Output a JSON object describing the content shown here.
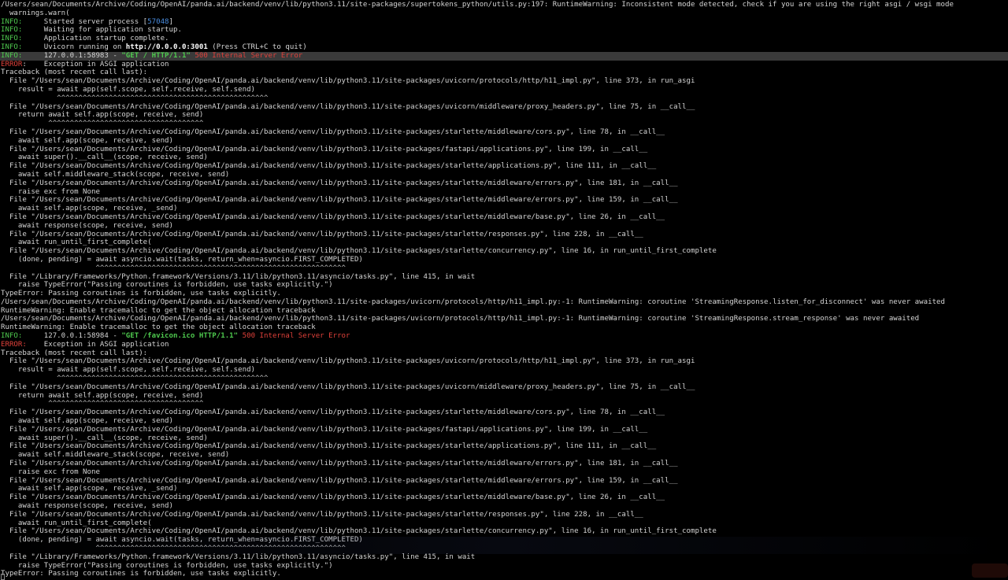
{
  "lines": [
    {
      "s": [
        {
          "t": "/Users/sean/Documents/Archive/Coding/OpenAI/panda.ai/backend/venv/lib/python3.11/site-packages/supertokens_python/utils.py:197: RuntimeWarning: Inconsistent mode detected, check if you are using the right asgi / wsgi mode"
        }
      ]
    },
    {
      "s": [
        {
          "t": "  warnings.warn("
        }
      ]
    },
    {
      "s": [
        {
          "t": "INFO:",
          "c": "info"
        },
        {
          "t": "     Started server process ["
        },
        {
          "t": "57048",
          "c": "pid"
        },
        {
          "t": "]"
        }
      ]
    },
    {
      "s": [
        {
          "t": "INFO:",
          "c": "info"
        },
        {
          "t": "     Waiting for application startup."
        }
      ]
    },
    {
      "s": [
        {
          "t": "INFO:",
          "c": "info"
        },
        {
          "t": "     Application startup complete."
        }
      ]
    },
    {
      "s": [
        {
          "t": "INFO:",
          "c": "info"
        },
        {
          "t": "     Uvicorn running on "
        },
        {
          "t": "http://0.0.0.0:3001",
          "c": "url"
        },
        {
          "t": " (Press CTRL+C to quit)"
        }
      ]
    },
    {
      "hl": true,
      "s": [
        {
          "t": "INFO:",
          "c": "info"
        },
        {
          "t": "     127.0.0.1:58983 - "
        },
        {
          "t": "\"GET / HTTP/1.1\"",
          "c": "req"
        },
        {
          "t": " "
        },
        {
          "t": "500 Internal Server Error",
          "c": "status"
        }
      ]
    },
    {
      "s": [
        {
          "t": "ERROR",
          "c": "error"
        },
        {
          "t": ":    Exception in ASGI application"
        }
      ]
    },
    {
      "s": [
        {
          "t": "Traceback (most recent call last):"
        }
      ]
    },
    {
      "s": [
        {
          "t": "  File \"/Users/sean/Documents/Archive/Coding/OpenAI/panda.ai/backend/venv/lib/python3.11/site-packages/uvicorn/protocols/http/h11_impl.py\", line 373, in run_asgi"
        }
      ]
    },
    {
      "s": [
        {
          "t": "    result = await app(self.scope, self.receive, self.send)"
        }
      ]
    },
    {
      "s": [
        {
          "t": "             ^^^^^^^^^^^^^^^^^^^^^^^^^^^^^^^^^^^^^^^^^^^^^^^^^",
          "c": "carets"
        }
      ]
    },
    {
      "s": [
        {
          "t": "  File \"/Users/sean/Documents/Archive/Coding/OpenAI/panda.ai/backend/venv/lib/python3.11/site-packages/uvicorn/middleware/proxy_headers.py\", line 75, in __call__"
        }
      ]
    },
    {
      "s": [
        {
          "t": "    return await self.app(scope, receive, send)"
        }
      ]
    },
    {
      "s": [
        {
          "t": "           ^^^^^^^^^^^^^^^^^^^^^^^^^^^^^^^^^^^^",
          "c": "carets"
        }
      ]
    },
    {
      "s": [
        {
          "t": "  File \"/Users/sean/Documents/Archive/Coding/OpenAI/panda.ai/backend/venv/lib/python3.11/site-packages/starlette/middleware/cors.py\", line 78, in __call__"
        }
      ]
    },
    {
      "s": [
        {
          "t": "    await self.app(scope, receive, send)"
        }
      ]
    },
    {
      "s": [
        {
          "t": "  File \"/Users/sean/Documents/Archive/Coding/OpenAI/panda.ai/backend/venv/lib/python3.11/site-packages/fastapi/applications.py\", line 199, in __call__"
        }
      ]
    },
    {
      "s": [
        {
          "t": "    await super().__call__(scope, receive, send)"
        }
      ]
    },
    {
      "s": [
        {
          "t": "  File \"/Users/sean/Documents/Archive/Coding/OpenAI/panda.ai/backend/venv/lib/python3.11/site-packages/starlette/applications.py\", line 111, in __call__"
        }
      ]
    },
    {
      "s": [
        {
          "t": "    await self.middleware_stack(scope, receive, send)"
        }
      ]
    },
    {
      "s": [
        {
          "t": "  File \"/Users/sean/Documents/Archive/Coding/OpenAI/panda.ai/backend/venv/lib/python3.11/site-packages/starlette/middleware/errors.py\", line 181, in __call__"
        }
      ]
    },
    {
      "s": [
        {
          "t": "    raise exc from None"
        }
      ]
    },
    {
      "s": [
        {
          "t": "  File \"/Users/sean/Documents/Archive/Coding/OpenAI/panda.ai/backend/venv/lib/python3.11/site-packages/starlette/middleware/errors.py\", line 159, in __call__"
        }
      ]
    },
    {
      "s": [
        {
          "t": "    await self.app(scope, receive, _send)"
        }
      ]
    },
    {
      "s": [
        {
          "t": "  File \"/Users/sean/Documents/Archive/Coding/OpenAI/panda.ai/backend/venv/lib/python3.11/site-packages/starlette/middleware/base.py\", line 26, in __call__"
        }
      ]
    },
    {
      "s": [
        {
          "t": "    await response(scope, receive, send)"
        }
      ]
    },
    {
      "s": [
        {
          "t": "  File \"/Users/sean/Documents/Archive/Coding/OpenAI/panda.ai/backend/venv/lib/python3.11/site-packages/starlette/responses.py\", line 228, in __call__"
        }
      ]
    },
    {
      "s": [
        {
          "t": "    await run_until_first_complete("
        }
      ]
    },
    {
      "s": [
        {
          "t": "  File \"/Users/sean/Documents/Archive/Coding/OpenAI/panda.ai/backend/venv/lib/python3.11/site-packages/starlette/concurrency.py\", line 16, in run_until_first_complete"
        }
      ]
    },
    {
      "s": [
        {
          "t": "    (done, pending) = await asyncio.wait(tasks, return_when=asyncio.FIRST_COMPLETED)"
        }
      ]
    },
    {
      "s": [
        {
          "t": "                      ^^^^^^^^^^^^^^^^^^^^^^^^^^^^^^^^^^^^^^^^^^^^^^^^^^^^^^^^^^",
          "c": "carets"
        }
      ]
    },
    {
      "s": [
        {
          "t": "  File \"/Library/Frameworks/Python.framework/Versions/3.11/lib/python3.11/asyncio/tasks.py\", line 415, in wait"
        }
      ]
    },
    {
      "s": [
        {
          "t": "    raise TypeError(\"Passing coroutines is forbidden, use tasks explicitly.\")"
        }
      ]
    },
    {
      "s": [
        {
          "t": "TypeError: Passing coroutines is forbidden, use tasks explicitly."
        }
      ]
    },
    {
      "s": [
        {
          "t": "/Users/sean/Documents/Archive/Coding/OpenAI/panda.ai/backend/venv/lib/python3.11/site-packages/uvicorn/protocols/http/h11_impl.py:-1: RuntimeWarning: coroutine 'StreamingResponse.listen_for_disconnect' was never awaited"
        }
      ]
    },
    {
      "s": [
        {
          "t": "RuntimeWarning: Enable tracemalloc to get the object allocation traceback"
        }
      ]
    },
    {
      "s": [
        {
          "t": "/Users/sean/Documents/Archive/Coding/OpenAI/panda.ai/backend/venv/lib/python3.11/site-packages/uvicorn/protocols/http/h11_impl.py:-1: RuntimeWarning: coroutine 'StreamingResponse.stream_response' was never awaited"
        }
      ]
    },
    {
      "s": [
        {
          "t": "RuntimeWarning: Enable tracemalloc to get the object allocation traceback"
        }
      ]
    },
    {
      "s": [
        {
          "t": "INFO:",
          "c": "info"
        },
        {
          "t": "     127.0.0.1:58984 - "
        },
        {
          "t": "\"GET /favicon.ico HTTP/1.1\"",
          "c": "req"
        },
        {
          "t": " "
        },
        {
          "t": "500 Internal Server Error",
          "c": "status"
        }
      ]
    },
    {
      "s": [
        {
          "t": "ERROR:",
          "c": "error"
        },
        {
          "t": "    Exception in ASGI application"
        }
      ]
    },
    {
      "s": [
        {
          "t": "Traceback (most recent call last):"
        }
      ]
    },
    {
      "s": [
        {
          "t": "  File \"/Users/sean/Documents/Archive/Coding/OpenAI/panda.ai/backend/venv/lib/python3.11/site-packages/uvicorn/protocols/http/h11_impl.py\", line 373, in run_asgi"
        }
      ]
    },
    {
      "s": [
        {
          "t": "    result = await app(self.scope, self.receive, self.send)"
        }
      ]
    },
    {
      "s": [
        {
          "t": "             ^^^^^^^^^^^^^^^^^^^^^^^^^^^^^^^^^^^^^^^^^^^^^^^^^",
          "c": "carets"
        }
      ]
    },
    {
      "s": [
        {
          "t": "  File \"/Users/sean/Documents/Archive/Coding/OpenAI/panda.ai/backend/venv/lib/python3.11/site-packages/uvicorn/middleware/proxy_headers.py\", line 75, in __call__"
        }
      ]
    },
    {
      "s": [
        {
          "t": "    return await self.app(scope, receive, send)"
        }
      ]
    },
    {
      "s": [
        {
          "t": "           ^^^^^^^^^^^^^^^^^^^^^^^^^^^^^^^^^^^^",
          "c": "carets"
        }
      ]
    },
    {
      "s": [
        {
          "t": "  File \"/Users/sean/Documents/Archive/Coding/OpenAI/panda.ai/backend/venv/lib/python3.11/site-packages/starlette/middleware/cors.py\", line 78, in __call__"
        }
      ]
    },
    {
      "s": [
        {
          "t": "    await self.app(scope, receive, send)"
        }
      ]
    },
    {
      "s": [
        {
          "t": "  File \"/Users/sean/Documents/Archive/Coding/OpenAI/panda.ai/backend/venv/lib/python3.11/site-packages/fastapi/applications.py\", line 199, in __call__"
        }
      ]
    },
    {
      "s": [
        {
          "t": "    await super().__call__(scope, receive, send)"
        }
      ]
    },
    {
      "s": [
        {
          "t": "  File \"/Users/sean/Documents/Archive/Coding/OpenAI/panda.ai/backend/venv/lib/python3.11/site-packages/starlette/applications.py\", line 111, in __call__"
        }
      ]
    },
    {
      "s": [
        {
          "t": "    await self.middleware_stack(scope, receive, send)"
        }
      ]
    },
    {
      "s": [
        {
          "t": "  File \"/Users/sean/Documents/Archive/Coding/OpenAI/panda.ai/backend/venv/lib/python3.11/site-packages/starlette/middleware/errors.py\", line 181, in __call__"
        }
      ]
    },
    {
      "s": [
        {
          "t": "    raise exc from None"
        }
      ]
    },
    {
      "s": [
        {
          "t": "  File \"/Users/sean/Documents/Archive/Coding/OpenAI/panda.ai/backend/venv/lib/python3.11/site-packages/starlette/middleware/errors.py\", line 159, in __call__"
        }
      ]
    },
    {
      "s": [
        {
          "t": "    await self.app(scope, receive, _send)"
        }
      ]
    },
    {
      "s": [
        {
          "t": "  File \"/Users/sean/Documents/Archive/Coding/OpenAI/panda.ai/backend/venv/lib/python3.11/site-packages/starlette/middleware/base.py\", line 26, in __call__"
        }
      ]
    },
    {
      "s": [
        {
          "t": "    await response(scope, receive, send)"
        }
      ]
    },
    {
      "s": [
        {
          "t": "  File \"/Users/sean/Documents/Archive/Coding/OpenAI/panda.ai/backend/venv/lib/python3.11/site-packages/starlette/responses.py\", line 228, in __call__"
        }
      ]
    },
    {
      "s": [
        {
          "t": "    await run_until_first_complete("
        }
      ]
    },
    {
      "s": [
        {
          "t": "  File \"/Users/sean/Documents/Archive/Coding/OpenAI/panda.ai/backend/venv/lib/python3.11/site-packages/starlette/concurrency.py\", line 16, in run_until_first_complete"
        }
      ]
    },
    {
      "s": [
        {
          "t": "    (done, pending) = await asyncio.wait(tasks, return_when=asyncio.FIRST_COMPLETED)"
        }
      ]
    },
    {
      "s": [
        {
          "t": "                      ^^^^^^^^^^^^^^^^^^^^^^^^^^^^^^^^^^^^^^^^^^^^^^^^^^^^^^^^^^",
          "c": "carets"
        }
      ]
    },
    {
      "s": [
        {
          "t": "  File \"/Library/Frameworks/Python.framework/Versions/3.11/lib/python3.11/asyncio/tasks.py\", line 415, in wait"
        }
      ]
    },
    {
      "s": [
        {
          "t": "    raise TypeError(\"Passing coroutines is forbidden, use tasks explicitly.\")"
        }
      ]
    },
    {
      "s": [
        {
          "t": "TypeError: Passing coroutines is forbidden, use tasks explicitly."
        }
      ]
    }
  ],
  "colors": {
    "background": "#000000",
    "text": "#d4d4d4",
    "info": "#4ec94e",
    "error": "#e0413a",
    "pid": "#4a8de0",
    "highlight_row": "#3a3a3a"
  }
}
